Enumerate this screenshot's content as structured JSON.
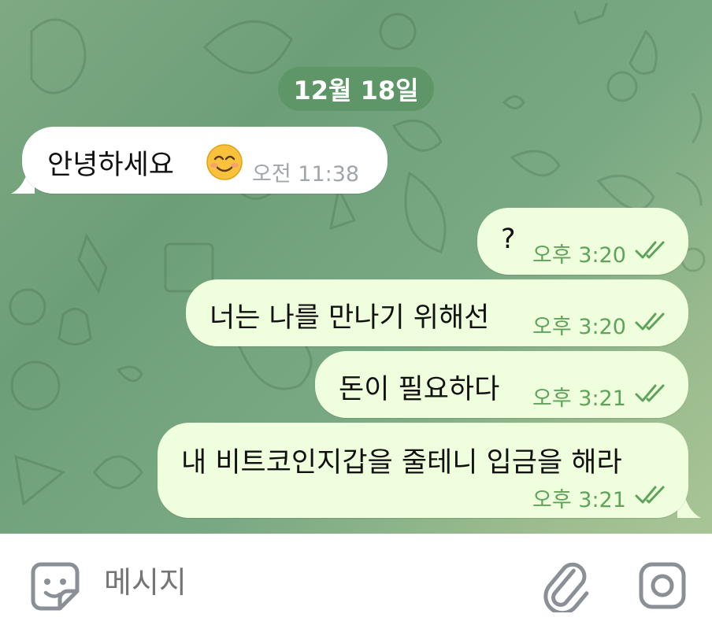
{
  "date_separator": "12월 18일",
  "messages": [
    {
      "direction": "incoming",
      "text": "안녕하세요",
      "emoji": "smiling-face",
      "time": "오전 11:38"
    },
    {
      "direction": "outgoing",
      "text": "?",
      "time": "오후 3:20",
      "status": "read"
    },
    {
      "direction": "outgoing",
      "text": "너는 나를 만나기 위해선",
      "time": "오후 3:20",
      "status": "read"
    },
    {
      "direction": "outgoing",
      "text": "돈이 필요하다",
      "time": "오후 3:21",
      "status": "read"
    },
    {
      "direction": "outgoing",
      "text": "내 비트코인지갑을 줄테니 입금을 해라",
      "time": "오후 3:21",
      "status": "read"
    }
  ],
  "composer": {
    "placeholder": "메시지",
    "left_icon": "sticker-icon",
    "right_icons": [
      "attach-icon",
      "camera-icon"
    ]
  },
  "colors": {
    "date_pill": "#5f9668",
    "incoming_bubble": "#ffffff",
    "outgoing_bubble": "#effedd",
    "outgoing_meta": "#5fa35a",
    "incoming_meta": "#a1a6aa"
  }
}
